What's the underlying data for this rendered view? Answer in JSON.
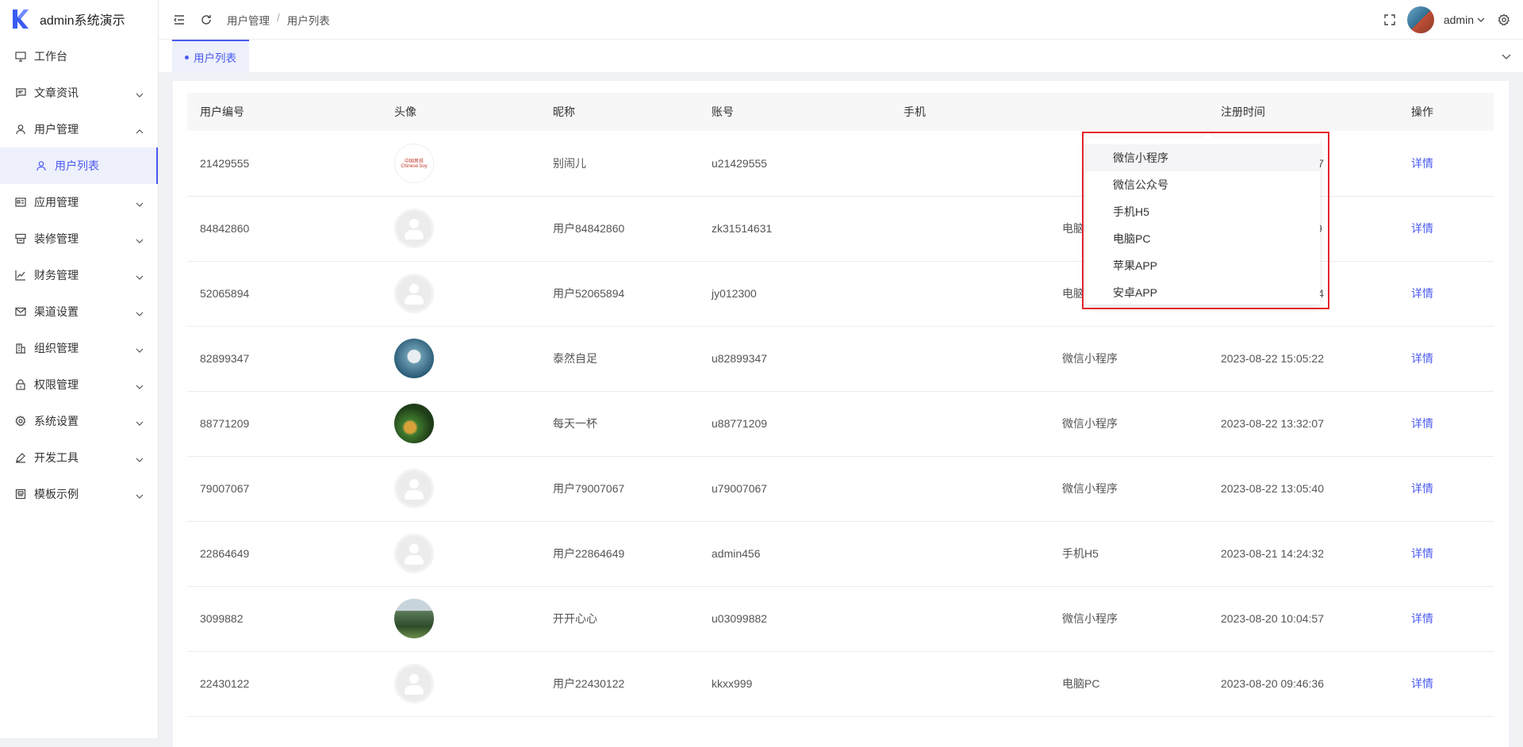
{
  "app": {
    "title": "admin系统演示"
  },
  "sidebar": {
    "items": [
      {
        "label": "工作台",
        "icon": "monitor-icon",
        "expandable": false
      },
      {
        "label": "文章资讯",
        "icon": "message-icon",
        "expandable": true
      },
      {
        "label": "用户管理",
        "icon": "user-icon",
        "expandable": true,
        "expanded": true
      },
      {
        "label": "用户列表",
        "icon": "user-icon",
        "sub": true,
        "active": true
      },
      {
        "label": "应用管理",
        "icon": "app-icon",
        "expandable": true
      },
      {
        "label": "装修管理",
        "icon": "decorate-icon",
        "expandable": true
      },
      {
        "label": "财务管理",
        "icon": "chart-icon",
        "expandable": true
      },
      {
        "label": "渠道设置",
        "icon": "mail-icon",
        "expandable": true
      },
      {
        "label": "组织管理",
        "icon": "building-icon",
        "expandable": true
      },
      {
        "label": "权限管理",
        "icon": "lock-icon",
        "expandable": true
      },
      {
        "label": "系统设置",
        "icon": "gear-icon",
        "expandable": true
      },
      {
        "label": "开发工具",
        "icon": "pen-icon",
        "expandable": true
      },
      {
        "label": "模板示例",
        "icon": "template-icon",
        "expandable": true
      }
    ]
  },
  "header": {
    "breadcrumb": [
      "用户管理",
      "用户列表"
    ],
    "breadcrumb_sep": "/",
    "username": "admin"
  },
  "tabs": [
    {
      "label": "用户列表",
      "active": true
    }
  ],
  "table": {
    "columns": [
      "用户编号",
      "头像",
      "昵称",
      "账号",
      "手机",
      "",
      "注册时间",
      "操作"
    ],
    "rows": [
      {
        "id": "21429555",
        "avatar": "logo",
        "nickname": "别闹儿",
        "account": "u21429555",
        "source": "",
        "time": "2023-08-23 18:22:57",
        "action": "详情"
      },
      {
        "id": "84842860",
        "avatar": "default",
        "nickname": "用户84842860",
        "account": "zk31514631",
        "source": "电脑PC",
        "time": "2023-08-23 11:11:49",
        "action": "详情"
      },
      {
        "id": "52065894",
        "avatar": "default",
        "nickname": "用户52065894",
        "account": "jy012300",
        "source": "电脑PC",
        "time": "2023-08-22 17:59:44",
        "action": "详情"
      },
      {
        "id": "82899347",
        "avatar": "photo-blue",
        "nickname": "泰然自足",
        "account": "u82899347",
        "source": "微信小程序",
        "time": "2023-08-22 15:05:22",
        "action": "详情"
      },
      {
        "id": "88771209",
        "avatar": "photo-green",
        "nickname": "每天一杯",
        "account": "u88771209",
        "source": "微信小程序",
        "time": "2023-08-22 13:32:07",
        "action": "详情"
      },
      {
        "id": "79007067",
        "avatar": "default",
        "nickname": "用户79007067",
        "account": "u79007067",
        "source": "微信小程序",
        "time": "2023-08-22 13:05:40",
        "action": "详情"
      },
      {
        "id": "22864649",
        "avatar": "default",
        "nickname": "用户22864649",
        "account": "admin456",
        "source": "手机H5",
        "time": "2023-08-21 14:24:32",
        "action": "详情"
      },
      {
        "id": "3099882",
        "avatar": "photo-landscape",
        "nickname": "开开心心",
        "account": "u03099882",
        "source": "微信小程序",
        "time": "2023-08-20 10:04:57",
        "action": "详情"
      },
      {
        "id": "22430122",
        "avatar": "default",
        "nickname": "用户22430122",
        "account": "kkxx999",
        "source": "电脑PC",
        "time": "2023-08-20 09:46:36",
        "action": "详情"
      }
    ]
  },
  "logo_avatar_text": [
    "中国男孩",
    "Chinese boy"
  ],
  "dropdown": {
    "options": [
      "微信小程序",
      "微信公众号",
      "手机H5",
      "电脑PC",
      "苹果APP",
      "安卓APP"
    ],
    "hover_index": 0
  },
  "colors": {
    "accent": "#4a5af0",
    "highlight_box": "#e3262b"
  }
}
